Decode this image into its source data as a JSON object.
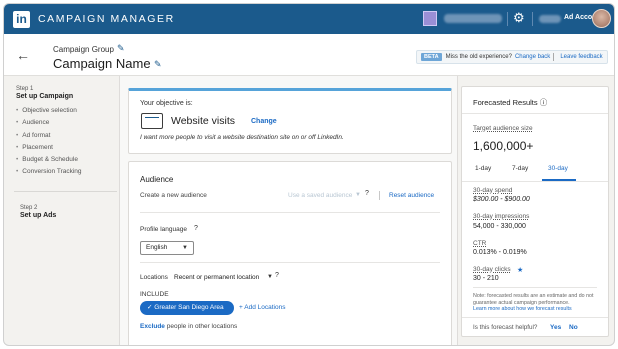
{
  "topbar": {
    "logo": "in",
    "app_title": "CAMPAIGN MANAGER",
    "gear_icon": "gear-icon",
    "ad_account_label": "Ad Account"
  },
  "header": {
    "group_label": "Campaign Group",
    "campaign_name": "Campaign Name",
    "beta_badge": "BETA",
    "beta_question": "Miss the old experience?",
    "change_back": "Change back",
    "leave_feedback": "Leave feedback"
  },
  "steps": {
    "step1_num": "Step 1",
    "step1_title": "Set up Campaign",
    "items": [
      "Objective selection",
      "Audience",
      "Ad format",
      "Placement",
      "Budget & Schedule",
      "Conversion Tracking"
    ],
    "step2_num": "Step 2",
    "step2_title": "Set up Ads"
  },
  "objective": {
    "label": "Your objective is:",
    "title": "Website visits",
    "change": "Change",
    "description": "I want more people to visit a website destination site on or off LinkedIn."
  },
  "audience": {
    "title": "Audience",
    "create_new": "Create a new audience",
    "use_saved": "Use a saved audience",
    "reset": "Reset audience",
    "profile_language_label": "Profile language",
    "profile_language_value": "English",
    "locations_label": "Locations",
    "locations_type": "Recent or permanent location",
    "include_label": "INCLUDE",
    "location_chip": "Greater San Diego Area",
    "add_locations": "Add Locations",
    "exclude_link": "Exclude",
    "exclude_rest": "people in other locations"
  },
  "forecast": {
    "title": "Forecasted Results",
    "target_label": "Target audience size",
    "target_value": "1,600,000+",
    "tabs": [
      "1-day",
      "7-day",
      "30-day"
    ],
    "active_tab": "30-day",
    "spend_label": "30-day spend",
    "spend_value": "$300.00 - $900.00",
    "impressions_label": "30-day impressions",
    "impressions_value": "54,000 - 330,000",
    "ctr_label": "CTR",
    "ctr_value": "0.013% - 0.019%",
    "clicks_label": "30-day clicks",
    "clicks_value": "30 - 210",
    "note": "Note: forecasted results are an estimate and do not guarantee actual campaign performance.",
    "note_link": "Learn more about how we forecast results",
    "helpful_q": "Is this forecast helpful?",
    "yes": "Yes",
    "no": "No"
  },
  "colors": {
    "topbar": "#1b5a8c",
    "link": "#1b6ac4",
    "accent_border": "#56a3d9"
  }
}
